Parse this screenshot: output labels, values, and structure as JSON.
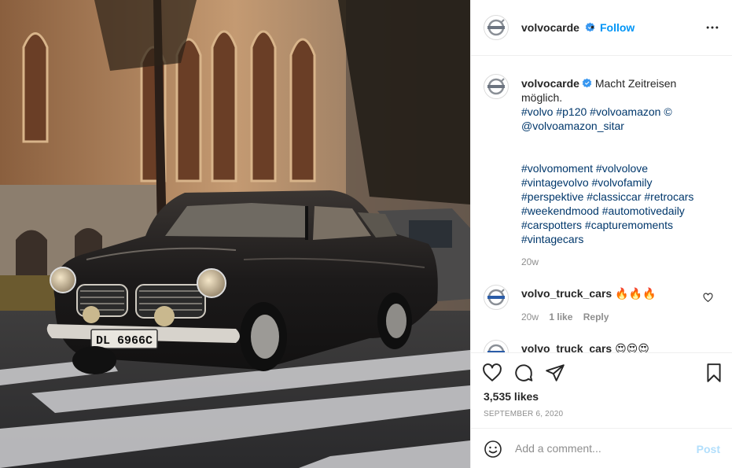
{
  "header": {
    "username": "volvocarde",
    "dot": "•",
    "follow_label": "Follow",
    "more_icon": "more-horizontal-icon"
  },
  "caption": {
    "username": "volvocarde",
    "line1_text": "Macht Zeitreisen",
    "line2_text": "möglich.",
    "tags_line1": "#volvo #p120 #volvoamazon ©",
    "tags_line2": "@volvoamazon_sitar",
    "hashtags": [
      "#volvomoment #volvolove",
      "#vintagevolvo #volvofamily",
      "#perspektive #classiccar #retrocars",
      "#weekendmood #automotivedaily",
      "#carspotters #capturemoments",
      "#vintagecars"
    ],
    "time": "20w"
  },
  "comments": [
    {
      "username": "volvo_truck_cars",
      "text": "🔥🔥🔥",
      "time": "20w",
      "likes": "1 like",
      "reply": "Reply"
    },
    {
      "username": "volvo_truck_cars",
      "text": "😍😍😍"
    }
  ],
  "actions": {
    "likes": "3,535 likes",
    "date": "SEPTEMBER 6, 2020",
    "icons": [
      "heart-icon",
      "comment-icon",
      "share-icon",
      "bookmark-icon"
    ]
  },
  "add_comment": {
    "placeholder": "Add a comment...",
    "post_label": "Post"
  },
  "colors": {
    "link": "#0095f6",
    "hashtag": "#00376b",
    "post_disabled": "#b2dffc",
    "muted": "#8e8e8e"
  },
  "photo": {
    "plate_text": "DL 6966C"
  }
}
